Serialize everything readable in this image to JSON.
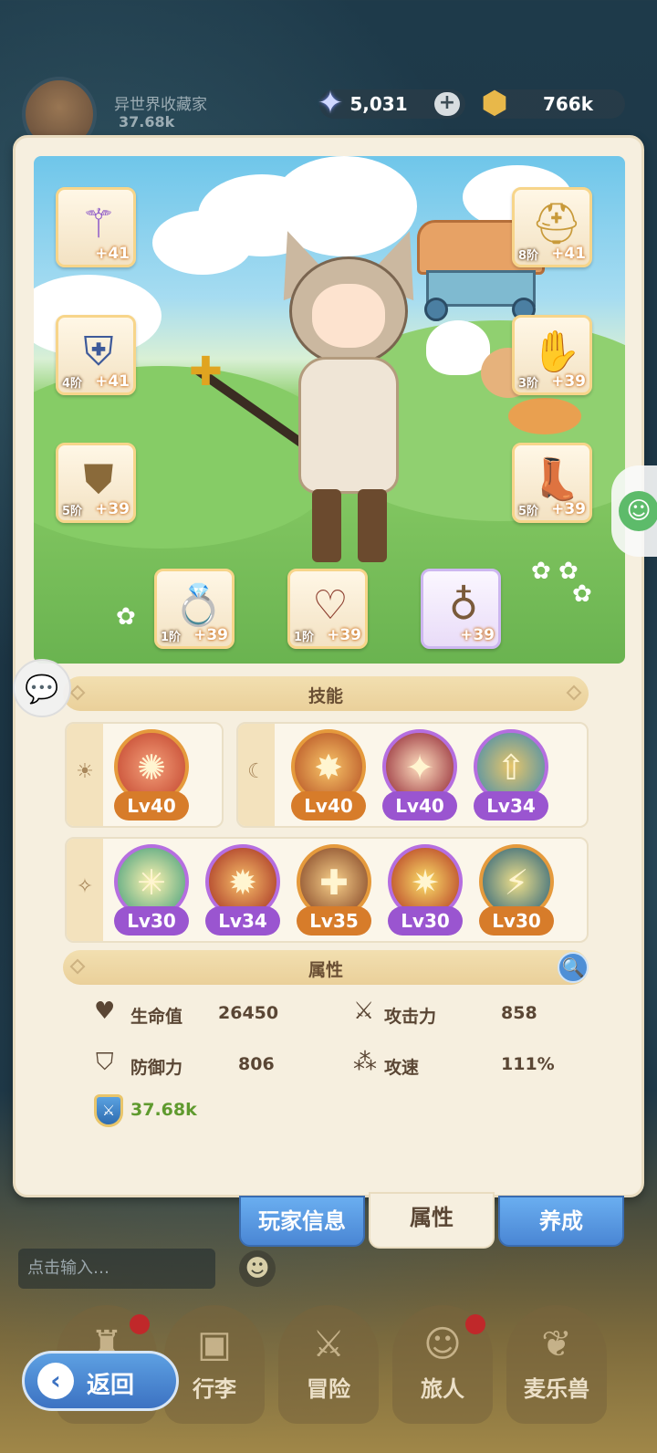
{
  "header": {
    "player_name": "异世界收藏家",
    "player_power": "37.68k",
    "gems": "5,031",
    "gold": "766k"
  },
  "equipment": {
    "weapon": {
      "tier": "",
      "level": "+41"
    },
    "helmet": {
      "tier": "8阶",
      "level": "+41"
    },
    "armor": {
      "tier": "4阶",
      "level": "+41"
    },
    "gloves": {
      "tier": "3阶",
      "level": "+39"
    },
    "belt": {
      "tier": "5阶",
      "level": "+39"
    },
    "boots": {
      "tier": "5阶",
      "level": "+39"
    },
    "ring": {
      "tier": "1阶",
      "level": "+39"
    },
    "necklace": {
      "tier": "1阶",
      "level": "+39"
    },
    "amulet": {
      "tier": "",
      "level": "+39"
    }
  },
  "skills": {
    "title": "技能",
    "row1_left": [
      {
        "lv": "Lv40"
      }
    ],
    "row1_right": [
      {
        "lv": "Lv40"
      },
      {
        "lv": "Lv40"
      },
      {
        "lv": "Lv34"
      }
    ],
    "row2": [
      {
        "lv": "Lv30"
      },
      {
        "lv": "Lv34"
      },
      {
        "lv": "Lv35"
      },
      {
        "lv": "Lv30"
      },
      {
        "lv": "Lv30"
      }
    ]
  },
  "attributes": {
    "title": "属性",
    "hp_label": "生命值",
    "hp_value": "26450",
    "atk_label": "攻击力",
    "atk_value": "858",
    "def_label": "防御力",
    "def_value": "806",
    "spd_label": "攻速",
    "spd_value": "111%",
    "power": "37.68k"
  },
  "tabs": {
    "player_info": "玩家信息",
    "attributes": "属性",
    "develop": "养成"
  },
  "chat": {
    "placeholder": "点击输入…"
  },
  "nav": {
    "back": "返回",
    "bag": "行李",
    "adventure": "冒险",
    "traveler": "旅人",
    "pet": "麦乐兽"
  },
  "colors": {
    "accent_orange": "#d77c2a",
    "accent_purple": "#9a55d0",
    "power_green": "#5f9a2e",
    "tab_blue": "#4a86d4"
  }
}
